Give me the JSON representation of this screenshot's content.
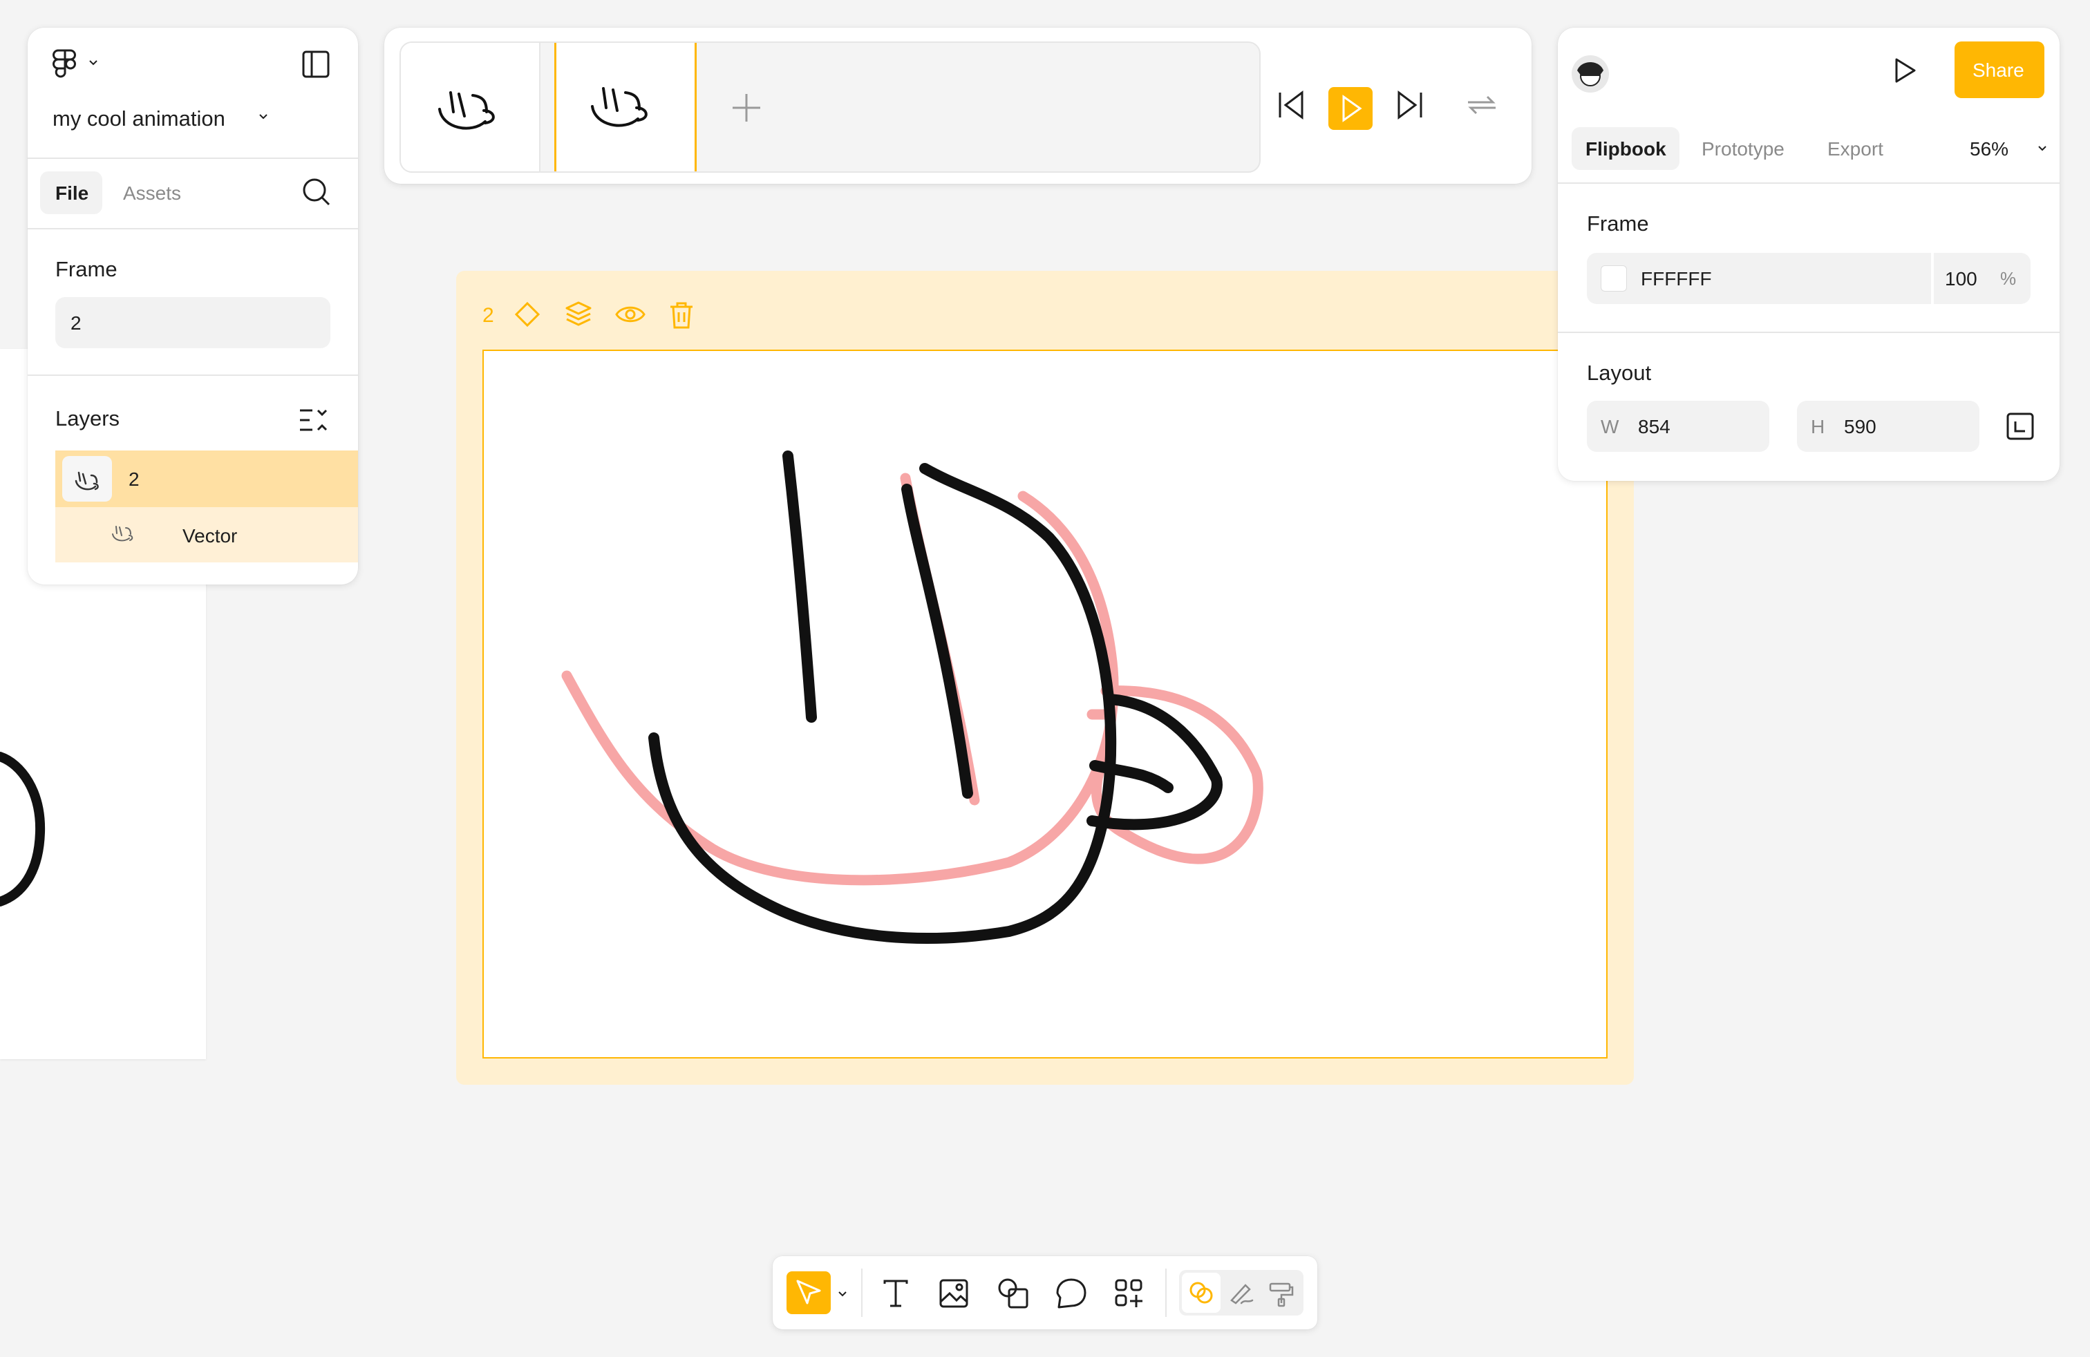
{
  "left_panel": {
    "file_name": "my cool animation",
    "tabs": [
      {
        "label": "File",
        "active": true
      },
      {
        "label": "Assets",
        "active": false
      }
    ],
    "frame_section": {
      "title": "Frame",
      "value": "2"
    },
    "layers_section": {
      "title": "Layers",
      "items": [
        {
          "label": "2",
          "selected": true
        },
        {
          "label": "Vector",
          "selected": false
        }
      ]
    }
  },
  "timeline": {
    "frames": [
      {
        "index": 1,
        "selected": false
      },
      {
        "index": 2,
        "selected": true
      }
    ],
    "controls": [
      "skip-back",
      "play",
      "skip-forward",
      "loop"
    ]
  },
  "canvas": {
    "frame_label": "2",
    "frame_toolbar": [
      "keyframe-icon",
      "layers-icon",
      "eye-icon",
      "trash-icon"
    ]
  },
  "right_panel": {
    "share_label": "Share",
    "tabs": [
      {
        "label": "Flipbook",
        "active": true
      },
      {
        "label": "Prototype",
        "active": false
      },
      {
        "label": "Export",
        "active": false
      }
    ],
    "zoom": "56%",
    "frame_section": {
      "title": "Frame",
      "fill_hex": "FFFFFF",
      "opacity": "100",
      "opacity_unit": "%"
    },
    "layout_section": {
      "title": "Layout",
      "w_label": "W",
      "w_value": "854",
      "h_label": "H",
      "h_value": "590"
    }
  },
  "bottom_toolbar": {
    "tools": [
      "select-tool",
      "text-tool",
      "image-tool",
      "shape-tool",
      "comment-tool",
      "components-tool"
    ],
    "modes": [
      "onion-skin",
      "draw-mode",
      "paint-mode"
    ]
  },
  "colors": {
    "accent": "#FFB703",
    "onion_skin": "#F7A6A6",
    "frame_bg": "#FFF0D0",
    "layer_selected": "#FFE0A3",
    "layer_child": "#FFF0D6"
  }
}
